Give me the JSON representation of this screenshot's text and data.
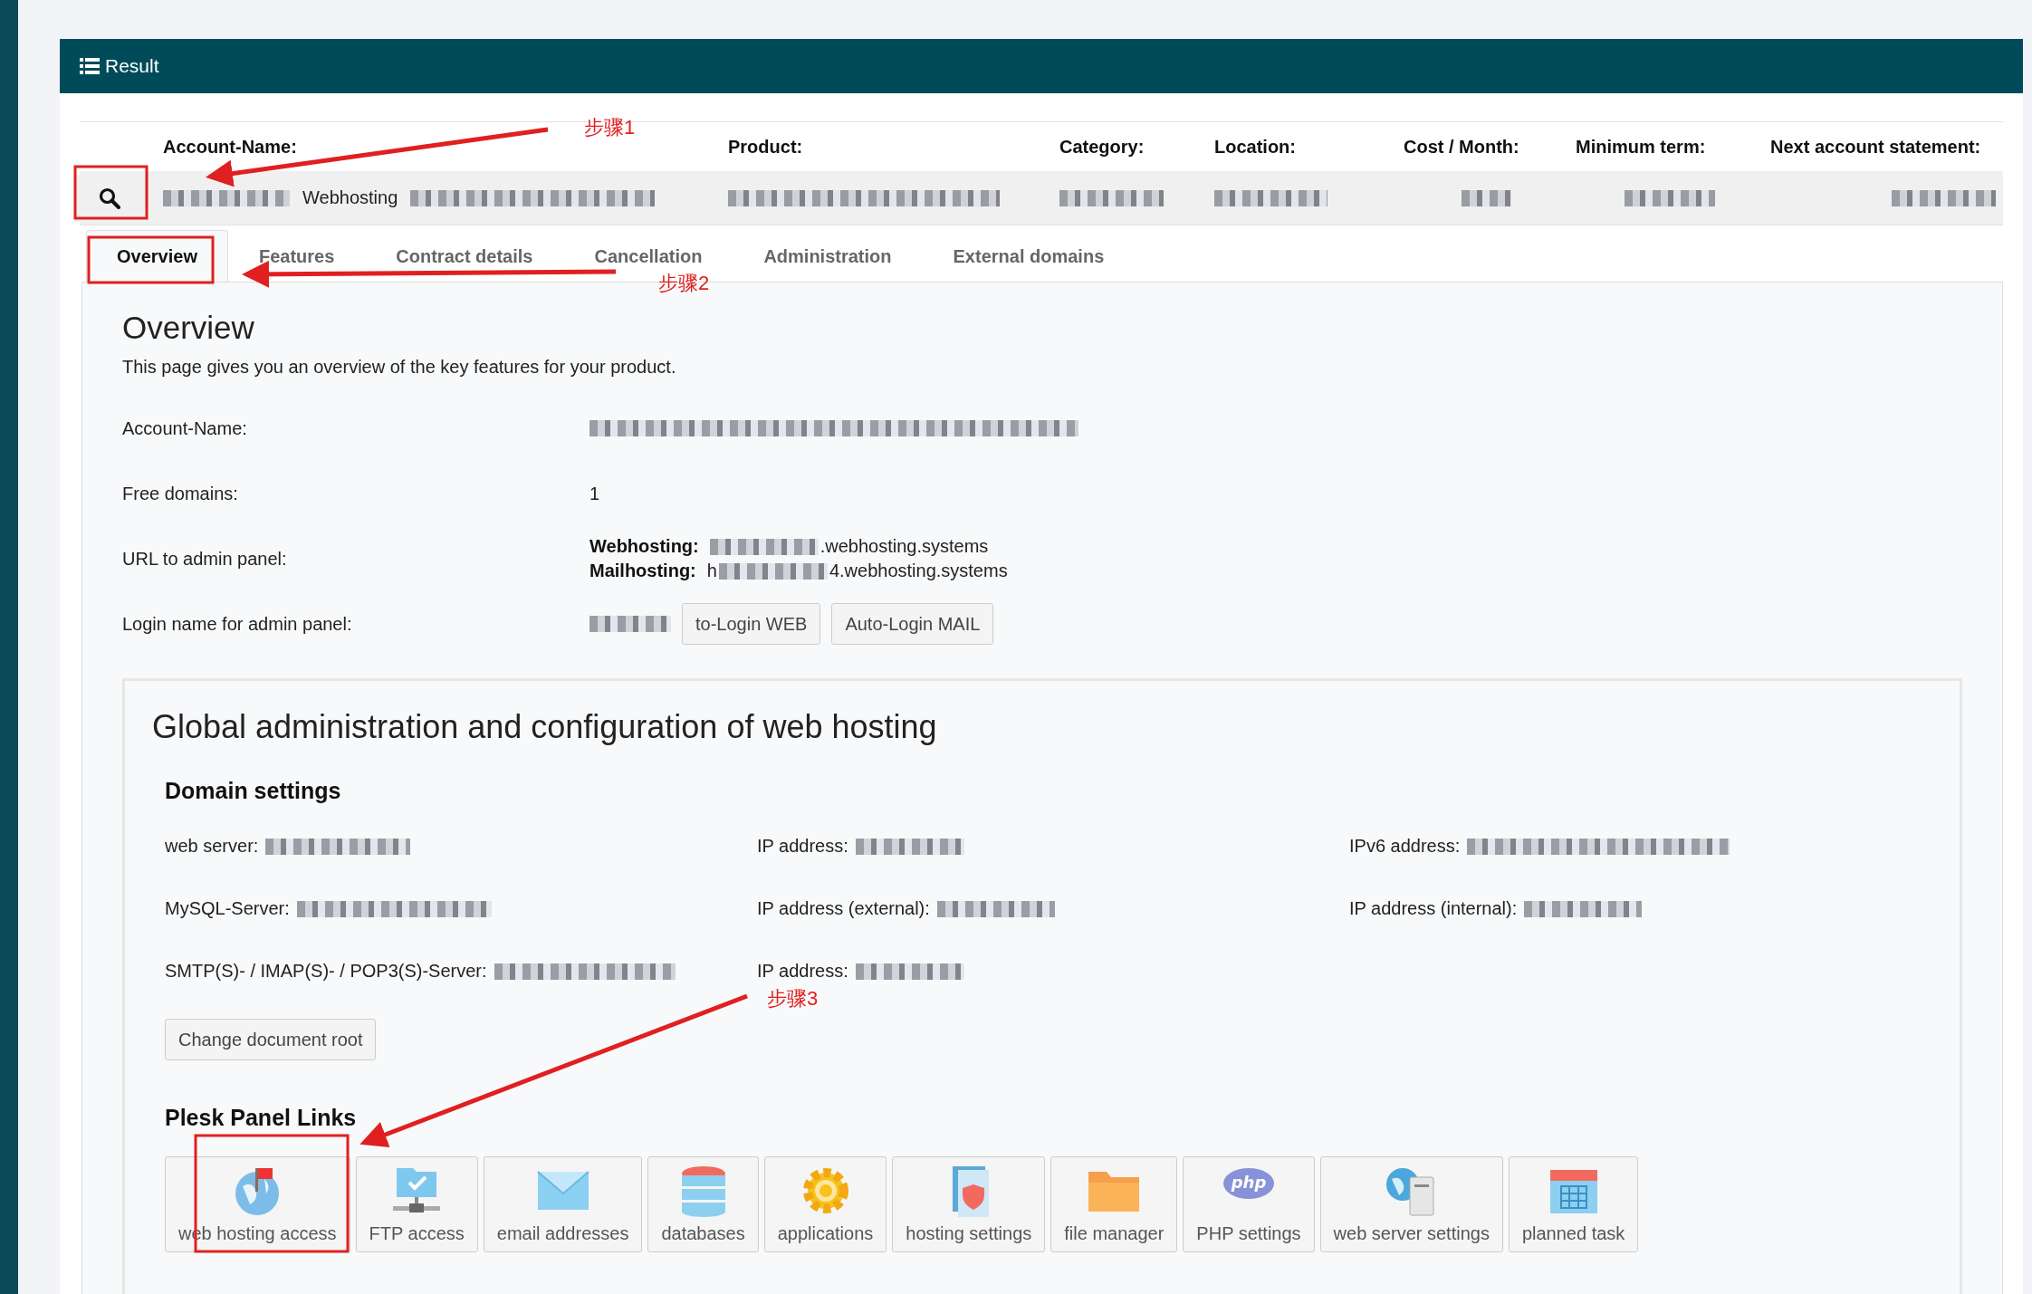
{
  "header": {
    "title": "Result"
  },
  "summary": {
    "columns": [
      "Account-Name:",
      "Product:",
      "Category:",
      "Location:",
      "Cost / Month:",
      "Minimum term:",
      "Next account statement:"
    ],
    "row": [
      [
        {
          "kind": "blur"
        },
        {
          "kind": "text",
          "text": "Webhosting"
        },
        {
          "kind": "blur"
        }
      ],
      [
        {
          "kind": "blur"
        }
      ],
      [
        {
          "kind": "blur"
        }
      ],
      [
        {
          "kind": "blur"
        }
      ],
      [
        {
          "kind": "blur"
        }
      ],
      [
        {
          "kind": "blur"
        }
      ],
      [
        {
          "kind": "blur"
        }
      ]
    ]
  },
  "tabs": [
    {
      "label": "Overview",
      "selected": true
    },
    {
      "label": "Features",
      "selected": false
    },
    {
      "label": "Contract details",
      "selected": false
    },
    {
      "label": "Cancellation",
      "selected": false
    },
    {
      "label": "Administration",
      "selected": false
    },
    {
      "label": "External domains",
      "selected": false
    }
  ],
  "overview": {
    "title": "Overview",
    "description": "This page gives you an overview of the key features for your product.",
    "rows": [
      {
        "label": "Account-Name:",
        "lines": [
          [
            {
              "kind": "blur"
            }
          ]
        ]
      },
      {
        "label": "Free domains:",
        "lines": [
          [
            {
              "kind": "text",
              "text": "1"
            }
          ]
        ]
      },
      {
        "label": "URL to admin panel:",
        "lines": [
          [
            {
              "kind": "bold",
              "text": "Webhosting:"
            },
            {
              "kind": "blur"
            },
            {
              "kind": "text",
              "text": ".webhosting.systems"
            }
          ],
          [
            {
              "kind": "bold",
              "text": "Mailhosting:"
            },
            {
              "kind": "text",
              "text": "h"
            },
            {
              "kind": "blur"
            },
            {
              "kind": "text",
              "text": "4.webhosting.systems"
            }
          ]
        ]
      },
      {
        "label": "Login name for admin panel:",
        "lines": [
          [
            {
              "kind": "blur"
            }
          ]
        ],
        "buttons": [
          "to-Login WEB",
          "Auto-Login MAIL"
        ]
      }
    ]
  },
  "global": {
    "title": "Global administration and configuration of web hosting",
    "domain_settings": {
      "title": "Domain settings",
      "rows": [
        [
          {
            "label": "web server:",
            "value": [
              {
                "kind": "blur"
              }
            ]
          },
          {
            "label": "IP address:",
            "value": [
              {
                "kind": "blur"
              }
            ]
          },
          {
            "label": "IPv6 address:",
            "value": [
              {
                "kind": "blur"
              }
            ]
          }
        ],
        [
          {
            "label": "MySQL-Server:",
            "value": [
              {
                "kind": "blur"
              }
            ]
          },
          {
            "label": "IP address (external):",
            "value": [
              {
                "kind": "blur"
              }
            ]
          },
          {
            "label": "IP address (internal):",
            "value": [
              {
                "kind": "blur"
              }
            ]
          }
        ],
        [
          {
            "label": "SMTP(S)- / IMAP(S)- / POP3(S)-Server:",
            "value": [
              {
                "kind": "blur"
              }
            ]
          },
          {
            "label": "IP address:",
            "value": [
              {
                "kind": "blur"
              }
            ]
          }
        ]
      ],
      "button": "Change document root"
    },
    "plesk": {
      "title": "Plesk Panel Links",
      "links": [
        {
          "label": "web hosting access"
        },
        {
          "label": "FTP access"
        },
        {
          "label": "email addresses"
        },
        {
          "label": "databases"
        },
        {
          "label": "applications"
        },
        {
          "label": "hosting settings"
        },
        {
          "label": "file manager"
        },
        {
          "label": "PHP settings",
          "icon_text": "php"
        },
        {
          "label": "web server settings"
        },
        {
          "label": "planned task"
        }
      ]
    }
  },
  "annotations": [
    "步骤1",
    "步骤2",
    "步骤3"
  ]
}
